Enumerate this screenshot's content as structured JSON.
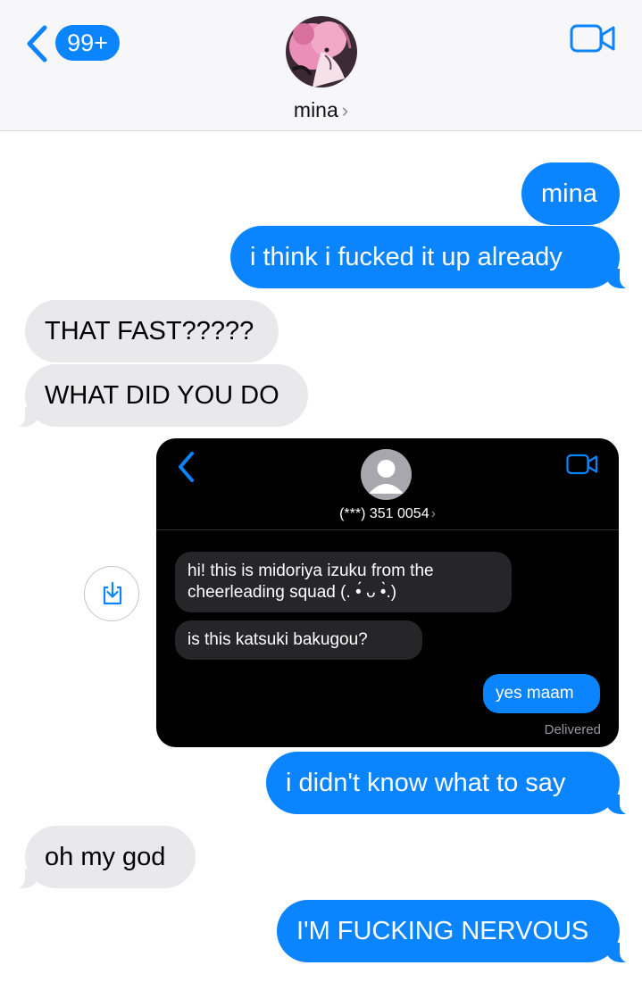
{
  "header": {
    "unread_badge": "99+",
    "contact_name": "mina",
    "contact_chevron": "›",
    "back_icon": "chevron-left-icon",
    "video_icon": "video-camera-icon"
  },
  "messages": [
    {
      "from": "me",
      "text": "mina"
    },
    {
      "from": "me",
      "text": "i think i fucked it up already"
    },
    {
      "from": "them",
      "text": "THAT FAST?????"
    },
    {
      "from": "them",
      "text": "WHAT DID YOU DO"
    },
    {
      "from": "me",
      "text": "i didn't know what to say"
    },
    {
      "from": "them",
      "text": "oh my god"
    },
    {
      "from": "me",
      "text": "I'M FUCKING NERVOUS"
    }
  ],
  "screenshot": {
    "contact_number": "(***) 351 0054",
    "contact_chevron": "›",
    "messages": [
      {
        "from": "them",
        "line1": "hi! this is midoriya izuku from the",
        "line2": "cheerleading squad (. •́ ᴗ •̀.)"
      },
      {
        "from": "them",
        "text": "is this katsuki bakugou?"
      },
      {
        "from": "me",
        "text": "yes maam"
      }
    ],
    "status": "Delivered"
  },
  "colors": {
    "sent_bubble": "#0a84ff",
    "received_bubble": "#e9e9eb",
    "header_bg": "#f7f7f9"
  }
}
